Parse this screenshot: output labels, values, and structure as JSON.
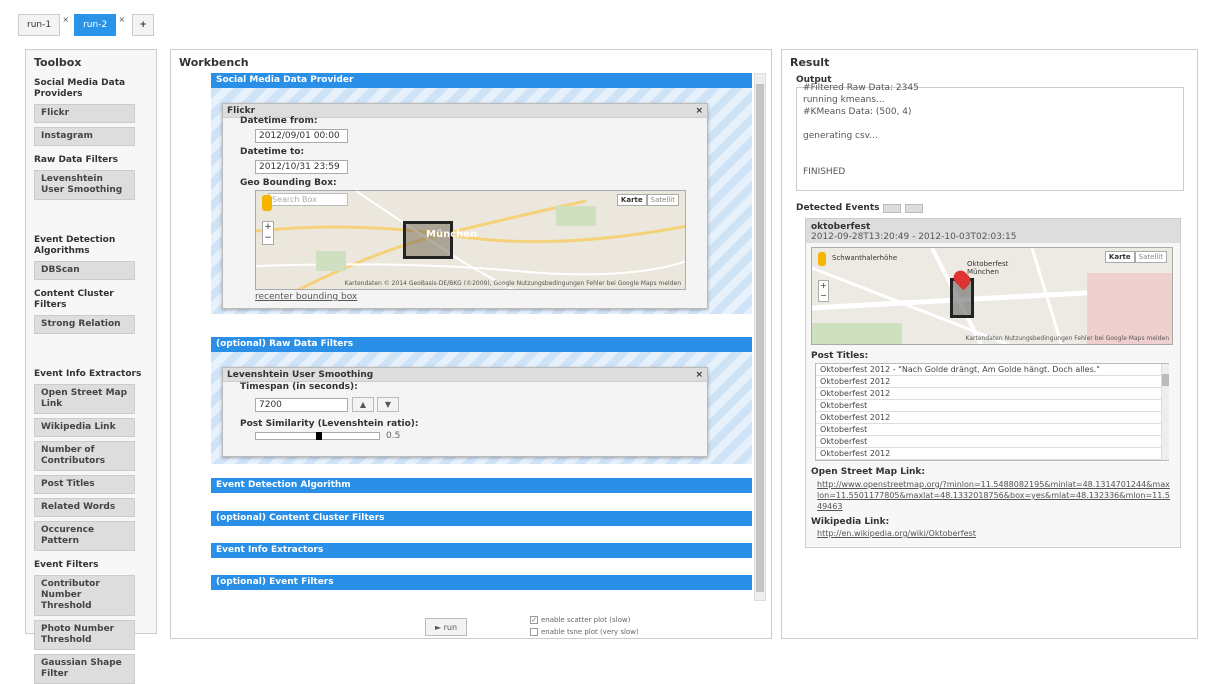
{
  "tabs": [
    {
      "label": "run-1",
      "close": "×"
    },
    {
      "label": "run-2",
      "close": "×"
    }
  ],
  "tab_add": "+",
  "toolbox": {
    "title": "Toolbox",
    "sections": [
      {
        "title": "Social Media Data Providers",
        "items": [
          "Flickr",
          "Instagram"
        ]
      },
      {
        "title": "Raw Data Filters",
        "items": [
          "Levenshtein User Smoothing"
        ]
      },
      {
        "title": "Event Detection Algorithms",
        "items": [
          "DBScan"
        ]
      },
      {
        "title": "Content Cluster Filters",
        "items": [
          "Strong Relation"
        ]
      },
      {
        "title": "Event Info Extractors",
        "items": [
          "Open Street Map Link",
          "Wikipedia Link",
          "Number of Contributors",
          "Post Titles",
          "Related Words",
          "Occurence Pattern"
        ]
      },
      {
        "title": "Event Filters",
        "items": [
          "Contributor Number Threshold",
          "Photo Number Threshold",
          "Gaussian Shape Filter"
        ]
      }
    ]
  },
  "workbench": {
    "title": "Workbench",
    "bars": [
      "Social Media Data Provider",
      "(optional) Raw Data Filters",
      "Event Detection Algorithm",
      "(optional) Content Cluster Filters",
      "Event Info Extractors",
      "(optional) Event Filters"
    ],
    "flickr": {
      "title": "Flickr",
      "close": "×",
      "from_label": "Datetime from:",
      "from_value": "2012/09/01 00:00",
      "to_label": "Datetime to:",
      "to_value": "2012/10/31 23:59",
      "geo_label": "Geo Bounding Box:",
      "search_placeholder": "Search Box",
      "map_karte": "Karte",
      "map_satellit": "Satellit",
      "map_city": "München",
      "map_attrib": "Kartendaten © 2014 GeoBasis-DE/BKG (©2009), Google   Nutzungsbedingungen   Fehler bei Google Maps melden",
      "recenter": "recenter bounding box"
    },
    "lev": {
      "title": "Levenshtein User Smoothing",
      "close": "×",
      "timespan_label": "Timespan (in seconds):",
      "timespan_value": "7200",
      "up": "▲",
      "down": "▼",
      "sim_label": "Post Similarity (Levenshtein ratio):",
      "sim_value": "0.5",
      "sim_fraction": 0.5
    },
    "run_label": "► run",
    "scatter_label": "enable scatter plot (slow)",
    "tsne_label": "enable tsne plot (very slow)"
  },
  "result": {
    "title": "Result",
    "output_label": "Output",
    "output_lines": [
      "#Filtered Raw Data: 2345",
      "running kmeans...",
      "#KMeans Data: (500, 4)",
      "",
      "generating csv...",
      "",
      "",
      "FINISHED"
    ],
    "events_label": "Detected Events",
    "event": {
      "name": "oktoberfest",
      "range": "2012-09-28T13:20:49 - 2012-10-03T02:03:15",
      "map_place": "Schwanthalerhöhe",
      "map_poi": "Oktoberfest München",
      "map_karte": "Karte",
      "map_satellit": "Satellit",
      "map_attrib": "Kartendaten   Nutzungsbedingungen   Fehler bei Google Maps melden",
      "post_titles_label": "Post Titles:",
      "post_titles": [
        "Oktoberfest 2012 - \"Nach Golde drängt, Am Golde hängt. Doch alles.\"",
        "Oktoberfest 2012",
        "Oktoberfest 2012",
        "Oktoberfest",
        "Oktoberfest 2012",
        "Oktoberfest",
        "Oktoberfest",
        "Oktoberfest 2012"
      ],
      "osm_label": "Open Street Map Link:",
      "osm_url": "http://www.openstreetmap.org/?minlon=11.5488082195&minlat=48.1314701244&maxlon=11.5501177805&maxlat=48.1332018756&box=yes&mlat=48.132336&mlon=11.549463",
      "wiki_label": "Wikipedia Link:",
      "wiki_url": "http://en.wikipedia.org/wiki/Oktoberfest"
    }
  }
}
